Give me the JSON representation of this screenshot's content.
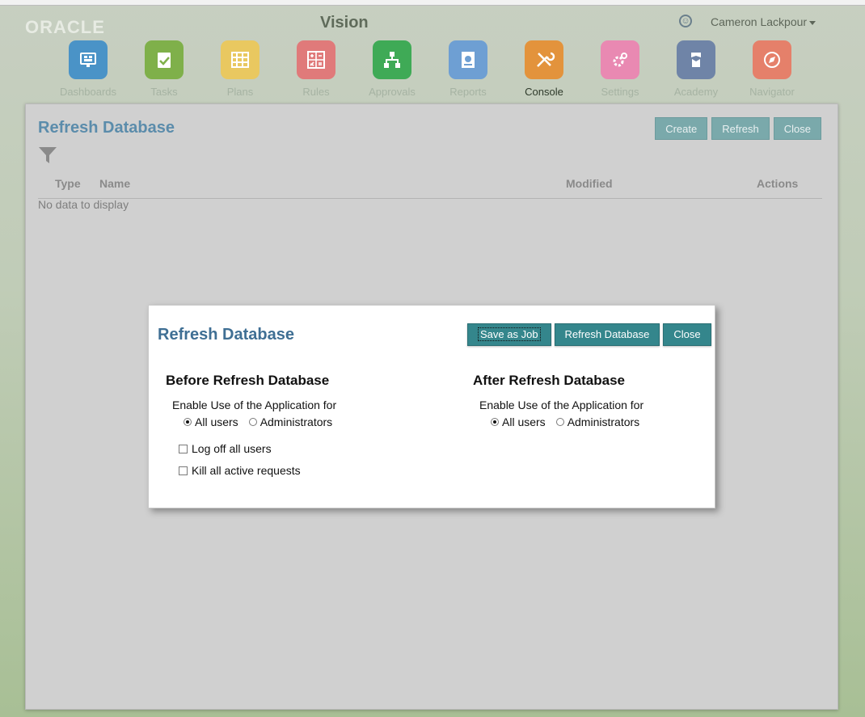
{
  "header": {
    "logo": "ORACLE",
    "app_name": "Vision",
    "user": "Cameron Lackpour"
  },
  "nav": [
    {
      "label": "Dashboards",
      "icon": "dashboards-icon",
      "color": "#4a93c7"
    },
    {
      "label": "Tasks",
      "icon": "tasks-icon",
      "color": "#7fb04a"
    },
    {
      "label": "Plans",
      "icon": "plans-icon",
      "color": "#e9c860"
    },
    {
      "label": "Rules",
      "icon": "rules-icon",
      "color": "#e07a7a"
    },
    {
      "label": "Approvals",
      "icon": "approvals-icon",
      "color": "#3faa56"
    },
    {
      "label": "Reports",
      "icon": "reports-icon",
      "color": "#6e9fd3"
    },
    {
      "label": "Console",
      "icon": "console-icon",
      "color": "#e3933c",
      "active": true
    },
    {
      "label": "Settings",
      "icon": "settings-icon",
      "color": "#e989b2"
    },
    {
      "label": "Academy",
      "icon": "academy-icon",
      "color": "#6f84a7"
    },
    {
      "label": "Navigator",
      "icon": "navigator-icon",
      "color": "#e5806a"
    }
  ],
  "panel": {
    "title": "Refresh Database",
    "buttons": {
      "create": "Create",
      "refresh": "Refresh",
      "close": "Close"
    },
    "columns": {
      "type": "Type",
      "name": "Name",
      "modified": "Modified",
      "actions": "Actions"
    },
    "empty": "No data to display"
  },
  "dialog": {
    "title": "Refresh Database",
    "buttons": {
      "save_job": "Save as Job",
      "refresh_db": "Refresh Database",
      "close": "Close"
    },
    "before": {
      "heading": "Before Refresh Database",
      "enable_label": "Enable Use of the Application for",
      "options": [
        "All users",
        "Administrators"
      ],
      "selected": "All users",
      "log_off": "Log off all users",
      "kill_requests": "Kill all active requests"
    },
    "after": {
      "heading": "After Refresh Database",
      "enable_label": "Enable Use of the Application for",
      "options": [
        "All users",
        "Administrators"
      ],
      "selected": "All users"
    }
  }
}
